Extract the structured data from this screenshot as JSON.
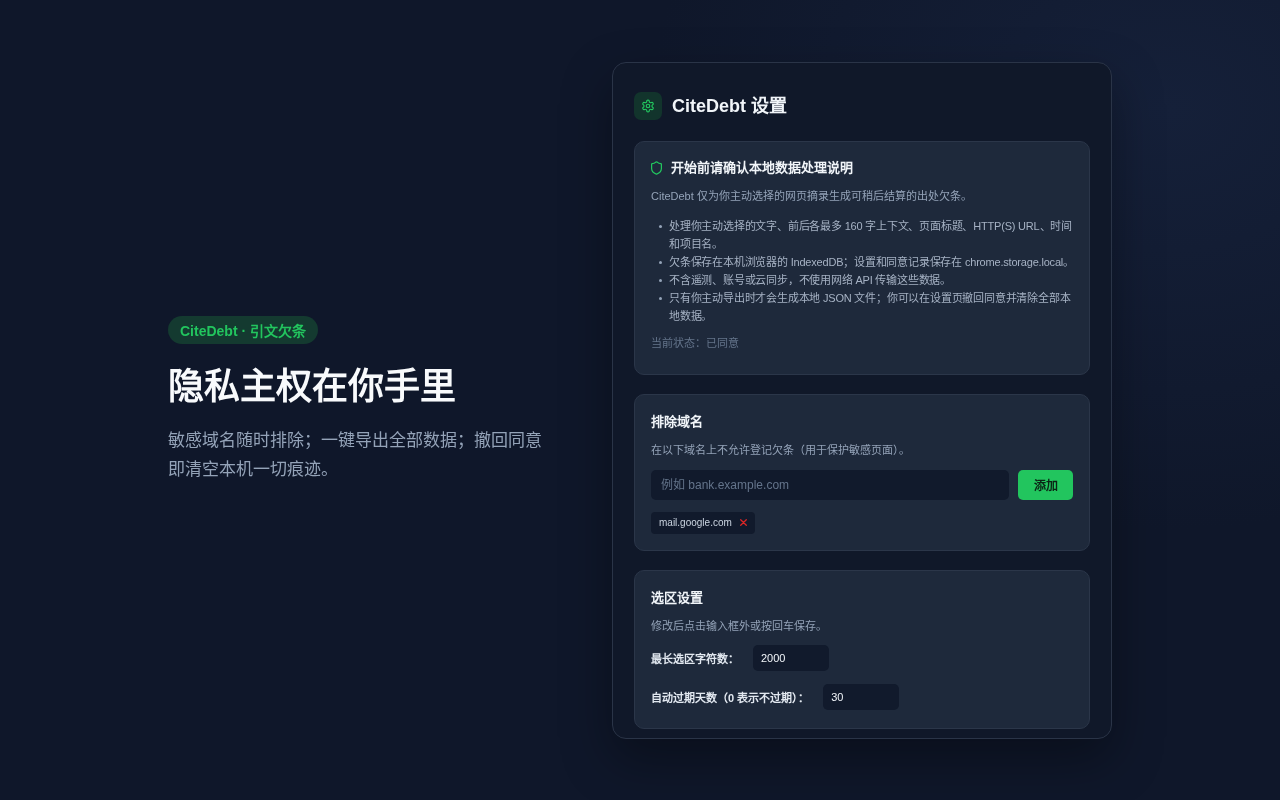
{
  "hero": {
    "badge": "CiteDebt · 引文欠条",
    "title": "隐私主权在你手里",
    "subtitle": "敏感域名随时排除；一键导出全部数据；撤回同意即清空本机一切痕迹。"
  },
  "settings_panel": {
    "title": "CiteDebt 设置",
    "consent_card": {
      "title": "开始前请确认本地数据处理说明",
      "intro": "CiteDebt 仅为你主动选择的网页摘录生成可稍后结算的出处欠条。",
      "items": [
        "处理你主动选择的文字、前后各最多 160 字上下文、页面标题、HTTP(S) URL、时间和项目名。",
        "欠条保存在本机浏览器的 IndexedDB；设置和同意记录保存在 chrome.storage.local。",
        "不含遥测、账号或云同步，不使用网络 API 传输这些数据。",
        "只有你主动导出时才会生成本地 JSON 文件；你可以在设置页撤回同意并清除全部本地数据。"
      ],
      "status": "当前状态：已同意"
    },
    "excluded_domains_card": {
      "title": "排除域名",
      "description": "在以下域名上不允许登记欠条（用于保护敏感页面）。",
      "input": {
        "placeholder": "例如 bank.example.com"
      },
      "add_button": "添加",
      "domains": [
        {
          "label": "mail.google.com"
        }
      ]
    },
    "selection_card": {
      "title": "选区设置",
      "description": "修改后点击输入框外或按回车保存。",
      "fields": [
        {
          "label": "最长选区字符数：",
          "value": "2000"
        },
        {
          "label": "自动过期天数（0 表示不过期）：",
          "value": "30"
        }
      ]
    }
  }
}
